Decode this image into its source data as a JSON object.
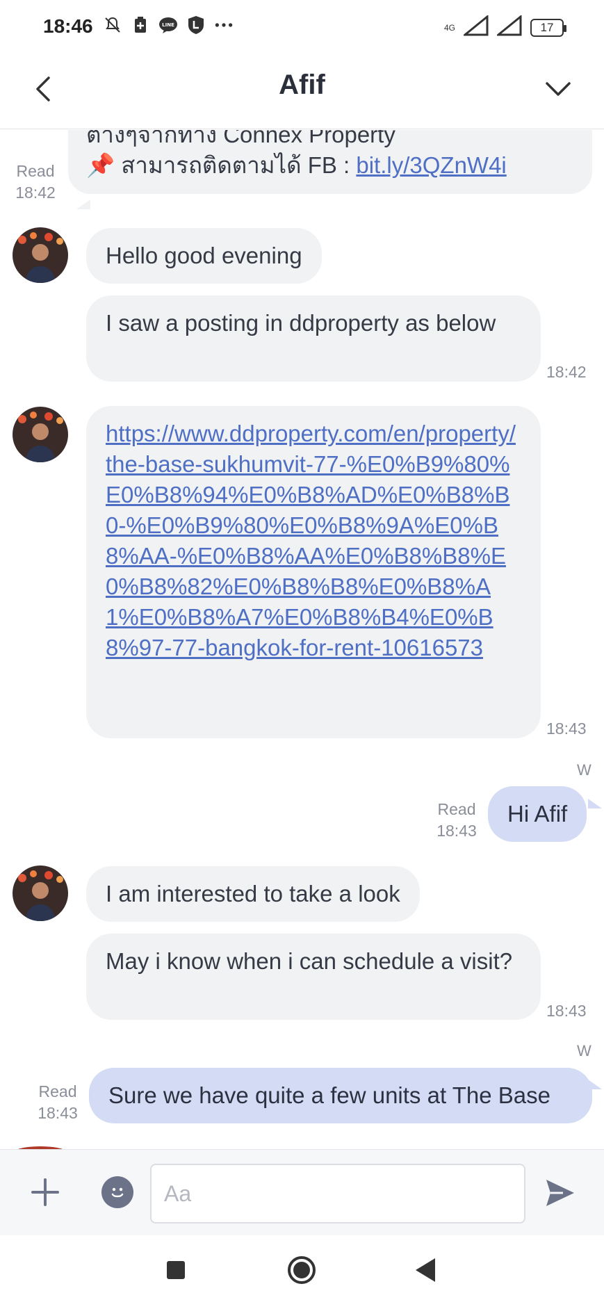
{
  "status_bar": {
    "time": "18:46",
    "icons": [
      "do-not-disturb-icon",
      "battery-saver-icon",
      "line-icon",
      "shield-icon",
      "more-dots-icon"
    ],
    "network": "4G",
    "battery": "17"
  },
  "header": {
    "title": "Afif"
  },
  "messages": {
    "m0": {
      "text_thai": "ต่างๆจากทาง Connex Property",
      "pin": "📌",
      "text_follow": "สามารถติดตามได้ FB : ",
      "link": "bit.ly/3QZnW4i",
      "status": "Read",
      "time": "18:42"
    },
    "m1": {
      "text": "Hello good evening"
    },
    "m2": {
      "text": "I saw a posting in ddproperty as below",
      "time": "18:42"
    },
    "m3": {
      "link": "https://www.ddproperty.com/en/property/the-base-sukhumvit-77-%E0%B9%80%E0%B8%94%E0%B8%AD%E0%B8%B0-%E0%B9%80%E0%B8%9A%E0%B8%AA-%E0%B8%AA%E0%B8%B8%E0%B8%82%E0%B8%B8%E0%B8%A1%E0%B8%A7%E0%B8%B4%E0%B8%97-77-bangkok-for-rent-10616573",
      "time": "18:43"
    },
    "m4": {
      "sender": "W",
      "text": "Hi Afif",
      "status": "Read",
      "time": "18:43"
    },
    "m5": {
      "text": "I am interested to take a look"
    },
    "m6": {
      "text": "May i know when i can schedule a visit?",
      "time": "18:43"
    },
    "m7": {
      "sender": "W",
      "text": "Sure we have quite a few units at The Base",
      "status": "Read",
      "time": "18:43"
    }
  },
  "composer": {
    "placeholder": "Aa"
  },
  "colors": {
    "incoming_bubble": "#f1f2f4",
    "outgoing_bubble": "#d3dcf4",
    "link": "#4e6fc4"
  }
}
